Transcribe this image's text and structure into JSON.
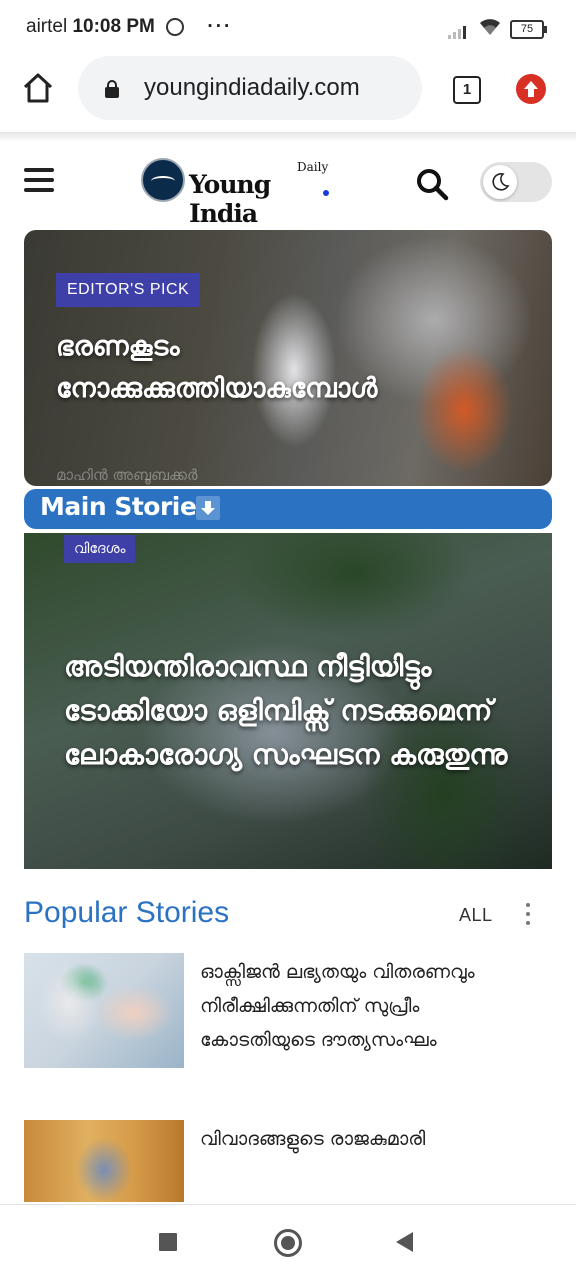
{
  "status_bar": {
    "carrier": "airtel",
    "time": "10:08 PM",
    "overflow": "···",
    "battery": "75",
    "icons": [
      "whatsapp-icon",
      "signal-icon",
      "wifi-icon",
      "battery-icon"
    ]
  },
  "browser": {
    "url": "youngindiadaily.com",
    "tab_count": "1",
    "icons": [
      "home-icon",
      "lock-icon",
      "tabs-icon",
      "update-icon"
    ]
  },
  "site_header": {
    "logo_name": "Young India",
    "logo_suffix": "Daily",
    "icons": [
      "menu-icon",
      "search-icon",
      "moon-icon"
    ],
    "dark_mode_enabled": false
  },
  "editors_pick": {
    "badge": "EDITOR'S PICK",
    "title": "ഭരണകൂടം നോക്കുക്കുത്തിയാകുമ്പോൾ",
    "author": "മാഹിൻ അബൂബക്കർ"
  },
  "main_stories": {
    "label": "Main Stories",
    "icon": "arrow-down-icon",
    "story": {
      "category": "വിദേശം",
      "title": "അടിയന്തിരാവസ്ഥ നീട്ടിയിട്ടും ടോക്കിയോ ഒളിമ്പിക്സ് നടക്കുമെന്ന് ലോകാരോഗ്യ സംഘടന കരുതുന്നു"
    }
  },
  "popular": {
    "title": "Popular Stories",
    "filter": "ALL",
    "items": [
      {
        "title": "ഓക്സിജൻ ലഭ്യതയും വിതരണവും നിരീക്ഷിക്കുന്നതിന് സുപ്രീം കോടതിയുടെ ദൗത്യസംഘം"
      },
      {
        "title": "വിവാദങ്ങളുടെ രാജകുമാരി"
      }
    ]
  },
  "system_nav": {
    "icons": [
      "recents-icon",
      "home-circle-icon",
      "back-icon"
    ]
  },
  "colors": {
    "accent_blue": "#2b73c2",
    "badge_purple": "#3f3fa8",
    "update_red": "#d93025"
  }
}
